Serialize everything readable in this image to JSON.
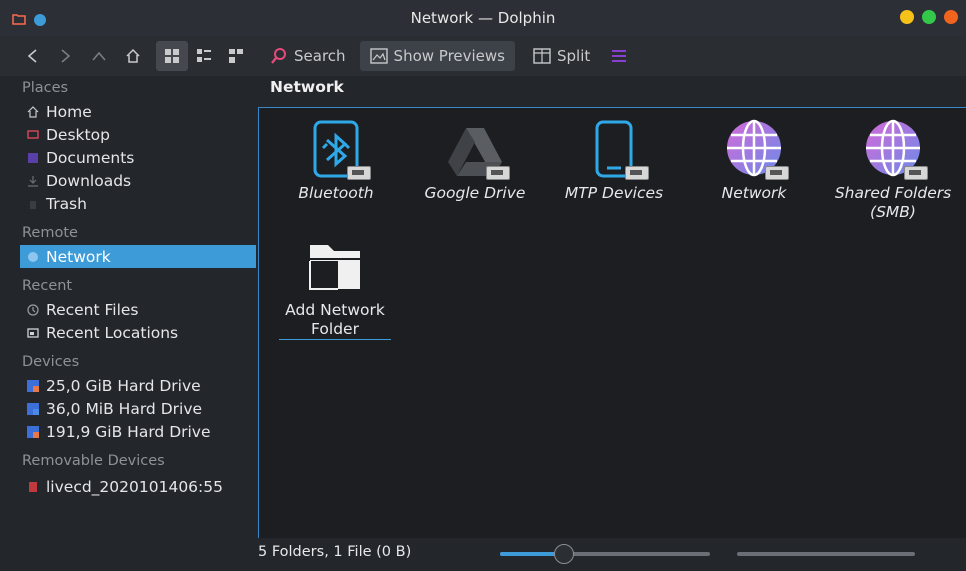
{
  "window": {
    "title": "Network — Dolphin"
  },
  "toolbar": {
    "search_label": "Search",
    "previews_label": "Show Previews",
    "split_label": "Split"
  },
  "sidebar": {
    "places_header": "Places",
    "places": [
      {
        "label": "Home",
        "icon": "home-icon"
      },
      {
        "label": "Desktop",
        "icon": "desktop-icon"
      },
      {
        "label": "Documents",
        "icon": "documents-icon"
      },
      {
        "label": "Downloads",
        "icon": "downloads-icon"
      },
      {
        "label": "Trash",
        "icon": "trash-icon"
      }
    ],
    "remote_header": "Remote",
    "remote": [
      {
        "label": "Network",
        "icon": "network-icon",
        "selected": true
      }
    ],
    "recent_header": "Recent",
    "recent": [
      {
        "label": "Recent Files",
        "icon": "recent-files-icon"
      },
      {
        "label": "Recent Locations",
        "icon": "recent-locations-icon"
      }
    ],
    "devices_header": "Devices",
    "devices": [
      {
        "label": "25,0 GiB Hard Drive",
        "icon": "hard-drive-icon"
      },
      {
        "label": "36,0 MiB Hard Drive",
        "icon": "hard-drive-icon"
      },
      {
        "label": "191,9 GiB Hard Drive",
        "icon": "hard-drive-icon"
      }
    ],
    "removable_header": "Removable Devices",
    "removable": [
      {
        "label": "livecd_2020101406:55",
        "icon": "optical-disc-icon"
      }
    ]
  },
  "breadcrumb": "Network",
  "files": [
    {
      "label": "Bluetooth",
      "icon": "bluetooth-icon"
    },
    {
      "label": "Google Drive",
      "icon": "google-drive-icon"
    },
    {
      "label": "MTP Devices",
      "icon": "mtp-device-icon"
    },
    {
      "label": "Network",
      "icon": "globe-icon"
    },
    {
      "label": "Shared Folders (SMB)",
      "icon": "globe-icon"
    },
    {
      "label": "Add Network Folder",
      "icon": "add-folder-icon"
    }
  ],
  "status": {
    "text": "5 Folders, 1 File (0 B)",
    "zoom_fraction": 0.3
  },
  "colors": {
    "accent": "#3d9bd8",
    "window_bg": "#23262b",
    "content_bg": "#1c1e21"
  }
}
